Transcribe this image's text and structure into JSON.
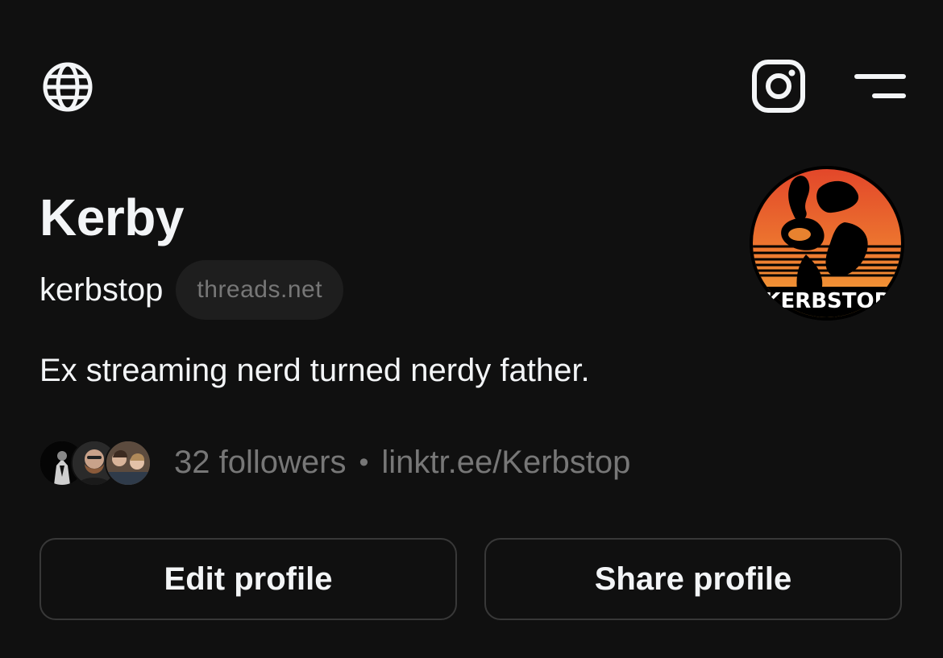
{
  "header": {
    "globe_icon": "globe-icon",
    "instagram_icon": "instagram-icon",
    "menu_icon": "menu-icon"
  },
  "profile": {
    "name": "Kerby",
    "username": "kerbstop",
    "domain_badge": "threads.net",
    "bio": "Ex streaming nerd turned nerdy father.",
    "avatar_text": "KERBSTOP",
    "followers": "32 followers",
    "separator": "•",
    "link": "linktr.ee/Kerbstop"
  },
  "actions": {
    "edit_label": "Edit profile",
    "share_label": "Share profile"
  },
  "colors": {
    "background": "#101010",
    "primary_text": "#f3f5f7",
    "secondary_text": "#777777",
    "border": "#383838",
    "avatar_gradient_top": "#e2452a",
    "avatar_gradient_bottom": "#f2a93b"
  }
}
